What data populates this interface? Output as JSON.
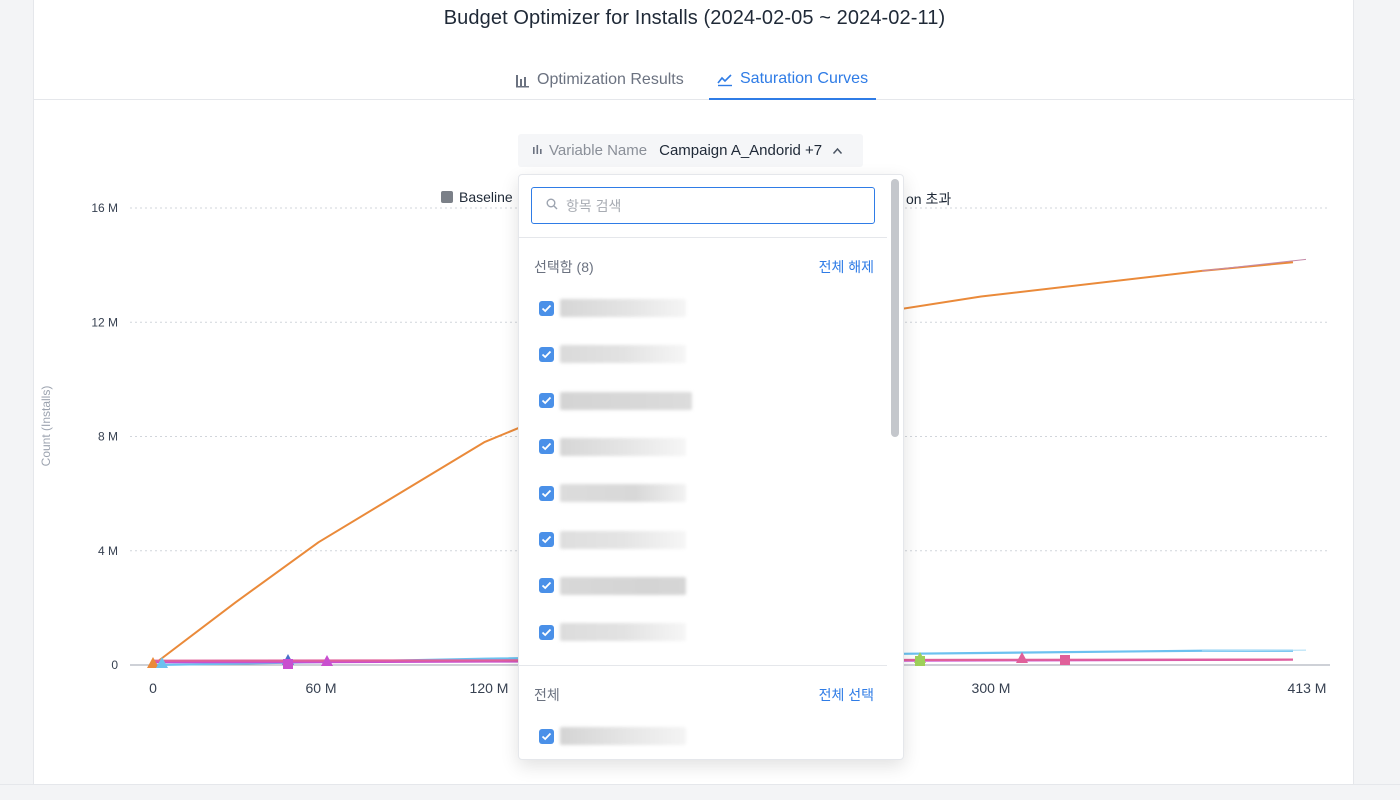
{
  "title": "Budget Optimizer for Installs (2024-02-05 ~ 2024-02-11)",
  "tabs": [
    {
      "label": "Optimization Results",
      "icon": "bar-chart-icon",
      "active": false
    },
    {
      "label": "Saturation Curves",
      "icon": "line-chart-icon",
      "active": true
    }
  ],
  "variable_select": {
    "label": "Variable Name",
    "value": "Campaign A_Andorid +7",
    "icon": "bar-chart-icon"
  },
  "legend": {
    "visible_left": "Baseline",
    "visible_right_fragment": "on 초과"
  },
  "dropdown": {
    "search_placeholder": "항목 검색",
    "selected_section": {
      "label": "선택함 (8)",
      "action": "전체 해제"
    },
    "all_section": {
      "label": "전체",
      "action": "전체 선택"
    },
    "selected_items": [
      {
        "checked": true,
        "redacted": true
      },
      {
        "checked": true,
        "redacted": true
      },
      {
        "checked": true,
        "redacted": true
      },
      {
        "checked": true,
        "redacted": true
      },
      {
        "checked": true,
        "redacted": true
      },
      {
        "checked": true,
        "redacted": true
      },
      {
        "checked": true,
        "redacted": true
      },
      {
        "checked": true,
        "redacted": true
      }
    ],
    "all_items_first": {
      "checked": true,
      "redacted": true
    }
  },
  "chart_data": {
    "type": "line",
    "title": "",
    "xlabel": "",
    "ylabel": "Count (Installs)",
    "x_ticks": [
      "0",
      "60 M",
      "120 M",
      "300 M",
      "413 M"
    ],
    "y_ticks": [
      "16 M",
      "12 M",
      "8 M",
      "4 M",
      "0"
    ],
    "xlim": [
      0,
      413000000
    ],
    "ylim": [
      0,
      16000000
    ],
    "grid": "horizontal dotted",
    "series": [
      {
        "color": "#ea8a3a",
        "x": [
          0,
          30000000,
          60000000,
          120000000,
          200000000,
          260000000,
          300000000,
          380000000,
          413000000
        ],
        "y": [
          0,
          2200000,
          4300000,
          7800000,
          11000000,
          12300000,
          12900000,
          13800000,
          14100000
        ]
      },
      {
        "color": "#6cc1ef",
        "x": [
          0,
          60000000,
          120000000,
          200000000,
          300000000,
          380000000,
          413000000
        ],
        "y": [
          0,
          100000,
          220000,
          320000,
          420000,
          500000,
          500000
        ]
      },
      {
        "color": "#c94fcf",
        "x": [
          0,
          60000000,
          120000000,
          200000000,
          300000000,
          380000000,
          413000000
        ],
        "y": [
          100000,
          100000,
          120000,
          140000,
          160000,
          180000,
          190000
        ]
      },
      {
        "color": "#e0609a",
        "x": [
          0,
          120000000,
          200000000,
          300000000,
          413000000
        ],
        "y": [
          150000,
          160000,
          170000,
          180000,
          190000
        ]
      }
    ]
  },
  "colors": {
    "accent": "#2f7ce6",
    "checkbox": "#4a90e8"
  }
}
